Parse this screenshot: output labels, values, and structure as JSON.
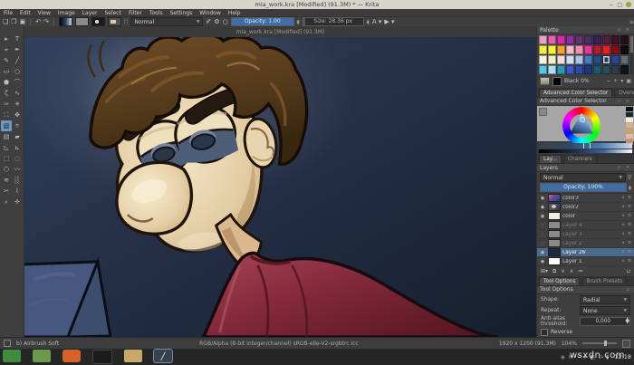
{
  "window": {
    "title": "mia_work.kra [Modified] (91.3M) * — Krita",
    "buttons": [
      "−",
      "□",
      "●"
    ]
  },
  "menu": {
    "items": [
      "File",
      "Edit",
      "View",
      "Image",
      "Layer",
      "Select",
      "Filter",
      "Tools",
      "Settings",
      "Window",
      "Help"
    ]
  },
  "toolbar": {
    "left_icons": [
      {
        "name": "new-document-icon",
        "glyph": "❏",
        "type": "glyph"
      },
      {
        "name": "open-document-icon",
        "glyph": "❐",
        "type": "glyph"
      },
      {
        "name": "save-icon",
        "glyph": "▣",
        "type": "glyph"
      },
      {
        "name": "separator",
        "type": "sep"
      },
      {
        "name": "undo-icon",
        "glyph": "↶",
        "type": "glyph"
      },
      {
        "name": "redo-icon",
        "glyph": "↷",
        "type": "glyph"
      },
      {
        "name": "separator",
        "type": "sep"
      },
      {
        "name": "gradient-chooser",
        "type": "gradient"
      },
      {
        "name": "pattern-chooser",
        "type": "pattern"
      },
      {
        "name": "brush-editor",
        "type": "brushdark"
      },
      {
        "name": "brush-presets-chooser",
        "type": "brushpreset"
      },
      {
        "name": "workspace-chooser-icon",
        "glyph": "∷",
        "type": "glyph"
      }
    ],
    "blend_mode": "Normal",
    "mid_icons": [
      {
        "name": "eraser-mode-icon",
        "glyph": "✐",
        "type": "glyph"
      },
      {
        "name": "reload-preset-icon",
        "glyph": "⚙",
        "type": "glyph"
      },
      {
        "name": "detach-icon",
        "glyph": "○",
        "type": "glyph"
      }
    ],
    "opacity_label": "Opacity: 1.00",
    "size_label": "Size: 28.36 px",
    "right_icons": [
      {
        "name": "assistant-tool-icon",
        "glyph": "A ▾",
        "type": "glyph"
      },
      {
        "name": "playback-icon",
        "glyph": "▶ ▾",
        "type": "glyph"
      }
    ],
    "overflow_glyph": "≡"
  },
  "toolbox": {
    "tools": [
      {
        "name": "tool-shape-select",
        "glyph": "▸"
      },
      {
        "name": "tool-text",
        "glyph": "T"
      },
      {
        "name": "tool-edit-shapes",
        "glyph": "⌖"
      },
      {
        "name": "tool-calligraphy",
        "glyph": "✒"
      },
      {
        "name": "tool-freehand-brush",
        "glyph": "✎"
      },
      {
        "name": "tool-line",
        "glyph": "╱"
      },
      {
        "name": "tool-rectangle",
        "glyph": "▭"
      },
      {
        "name": "tool-ellipse",
        "glyph": "○"
      },
      {
        "name": "tool-polygon",
        "glyph": "⬟"
      },
      {
        "name": "tool-polyline",
        "glyph": "⌒"
      },
      {
        "name": "tool-bezier",
        "glyph": "ζ"
      },
      {
        "name": "tool-freehand-path",
        "glyph": "∿"
      },
      {
        "name": "tool-dynamic-brush",
        "glyph": "✑"
      },
      {
        "name": "tool-multibrush",
        "glyph": "✳"
      },
      {
        "name": "tool-transform",
        "glyph": "⛶"
      },
      {
        "name": "tool-move",
        "glyph": "✥"
      },
      {
        "name": "tool-gradient",
        "glyph": "▨",
        "selected": true
      },
      {
        "name": "tool-color-sampler",
        "glyph": "⌾"
      },
      {
        "name": "tool-pattern-edit",
        "glyph": "▤"
      },
      {
        "name": "tool-fill",
        "glyph": "▰"
      },
      {
        "name": "tool-assistants",
        "glyph": "◺"
      },
      {
        "name": "tool-measure",
        "glyph": "⊾"
      },
      {
        "name": "tool-rect-select",
        "glyph": "⬚"
      },
      {
        "name": "tool-ellipse-select",
        "glyph": "◌"
      },
      {
        "name": "tool-polygon-select",
        "glyph": "⬡"
      },
      {
        "name": "tool-freehand-select",
        "glyph": "〰"
      },
      {
        "name": "tool-similar-select",
        "glyph": "≋"
      },
      {
        "name": "tool-contiguous-select",
        "glyph": "░"
      },
      {
        "name": "tool-path-select",
        "glyph": "✂"
      },
      {
        "name": "tool-magnetic-select",
        "glyph": "⌇"
      },
      {
        "name": "tool-zoom",
        "glyph": "⌕"
      },
      {
        "name": "tool-pan",
        "glyph": "✛"
      }
    ]
  },
  "canvas": {
    "subwindow_title": "mia_work.kra [Modified] (91.3M)",
    "colors": {
      "background_light": "#2e3b55",
      "background_dark": "#182232",
      "skin_light": "#f2e4c4",
      "skin_shadow": "#c0a077",
      "hair_mid": "#5c3c1e",
      "sweater": "#8e3242",
      "eye_lid_blue": "#4c5d78",
      "board_blue": "#46587e"
    }
  },
  "palette": {
    "title": "Palette",
    "colors": [
      [
        "#e7a3c4",
        "#e460b4",
        "#d02ea6",
        "#8f2f9e",
        "#643173",
        "#4f2f63",
        "#3a2352",
        "#51203f",
        "#3f1226",
        "#23101c"
      ],
      [
        "#f2ee45",
        "#f6f13b",
        "#f2a430",
        "#f4bccb",
        "#f290ac",
        "#e23a9c",
        "#b02030",
        "#e02028",
        "#801018",
        "#120a0c"
      ],
      [
        "#f6f2e8",
        "#f6efc3",
        "#f6dce2",
        "#cfdff0",
        "#a9c5e8",
        "#4b79bf",
        "#274a88",
        "#1d3666",
        "#2a4490",
        "#626b7a"
      ],
      [
        "#57c7e8",
        "#a9dff0",
        "#2f98b8",
        "#3a59c7",
        "#2b49a8",
        "#1b3a79",
        "#1d5a6a",
        "#2b4a5a",
        "#323a46",
        "#11151a"
      ]
    ],
    "selected": {
      "row": 2,
      "col": 7
    },
    "current_color_label": "Black 0%",
    "footer_buttons": [
      "−",
      "+",
      "▾",
      "▣"
    ]
  },
  "tab_rows": [
    {
      "items": [
        {
          "label": "Advanced Color Selector",
          "active": true
        },
        {
          "label": "Overview",
          "active": false
        }
      ]
    },
    {
      "items": [
        {
          "label": "Lay...",
          "active": true
        },
        {
          "label": "Channels",
          "active": false
        }
      ]
    },
    {
      "items": [
        {
          "label": "Tool Options",
          "active": true
        },
        {
          "label": "Brush Presets",
          "active": false
        }
      ]
    }
  ],
  "acs": {
    "title": "Advanced Color Selector",
    "history_colors": [
      "#0c1018",
      "#1a2434",
      "#f4ecd8",
      "#d9b088",
      "#caa06a",
      "#e8b89a",
      "#c4907c"
    ]
  },
  "layers": {
    "title": "Layers",
    "blend_mode": "Normal",
    "opacity_label": "Opacity: 100%",
    "items": [
      {
        "name": "color3",
        "visible": true,
        "thumb": "multicolor",
        "selected": false
      },
      {
        "name": "color2",
        "visible": true,
        "thumb": "artwork",
        "selected": false
      },
      {
        "name": "color",
        "visible": true,
        "thumb": "sketch",
        "selected": false
      },
      {
        "name": "Layer 4",
        "visible": false,
        "thumb": "gray",
        "selected": false
      },
      {
        "name": "Layer 3",
        "visible": false,
        "thumb": "gray",
        "selected": false
      },
      {
        "name": "Layer 2",
        "visible": false,
        "thumb": "gray",
        "selected": false
      },
      {
        "name": "Layer 26",
        "visible": true,
        "thumb": "navy",
        "selected": true
      },
      {
        "name": "Layer 1",
        "visible": true,
        "thumb": "white",
        "selected": false
      }
    ],
    "row_icons": [
      "α",
      "⚙"
    ],
    "footer_buttons": [
      "⊞▾",
      "⧉",
      "∨",
      "∧",
      "≔"
    ],
    "trash_glyph": "⊔"
  },
  "tool_options": {
    "title": "Tool Options",
    "shape_label": "Shape:",
    "shape_value": "Radial",
    "repeat_label": "Repeat:",
    "repeat_value": "None",
    "aa_label": "Anti-alias threshold:",
    "aa_value": "0,000",
    "reverse_label": "Reverse"
  },
  "statusbar": {
    "brush_preset": "b) Airbrush Soft",
    "colorspace": "RGB/Alpha (8-bit integer/channel)  sRGB-elle-V2-srgbtrc.icc",
    "image_size": "1920 x 1200 (91.3M)",
    "zoom": "104%"
  },
  "taskbar": {
    "apps": [
      {
        "name": "taskbar-terminal",
        "style": "app-terminal"
      },
      {
        "name": "taskbar-files",
        "style": "app-files"
      },
      {
        "name": "taskbar-ubuntu",
        "style": "app-ubuntu"
      },
      {
        "name": "taskbar-dark-app",
        "style": "app-dark"
      },
      {
        "name": "taskbar-folder",
        "style": "app-folder"
      },
      {
        "name": "taskbar-krita",
        "style": "app-krita",
        "active": true,
        "glyph": "╱"
      }
    ],
    "tray_icons": [
      "◈",
      "✉",
      "⌽",
      "▾",
      "◧",
      "♪",
      "▮"
    ],
    "time": "12:18"
  },
  "watermark": "wsxdn.com"
}
